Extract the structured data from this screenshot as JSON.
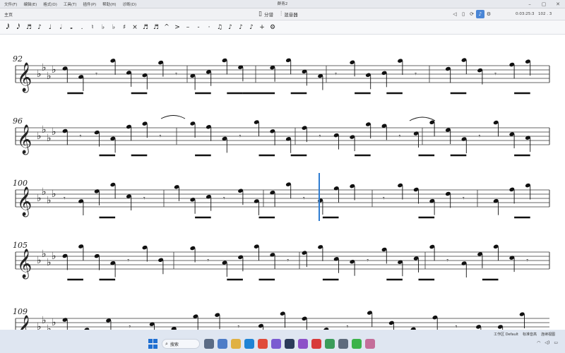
{
  "window": {
    "title": "群青2"
  },
  "menu": {
    "items": [
      "文件(F)",
      "编辑(E)",
      "格式(O)",
      "工具(T)",
      "插件(P)",
      "帮助(H)",
      "诊断(D)"
    ]
  },
  "toolbar1": {
    "home_tab": "主页",
    "mode_split": "分谱",
    "mode_mixer": "混音器",
    "playback_time": "0:03:25:3",
    "measure_beat": "102 . 3"
  },
  "note_toolbar": {
    "items": [
      {
        "name": "sixty-fourth-note",
        "glyph": "𝅘𝅥𝅱"
      },
      {
        "name": "thirty-second-note",
        "glyph": "𝅘𝅥𝅰"
      },
      {
        "name": "sixteenth-note",
        "glyph": "♬"
      },
      {
        "name": "eighth-note",
        "glyph": "♪"
      },
      {
        "name": "quarter-note",
        "glyph": "♩"
      },
      {
        "name": "half-note",
        "glyph": "𝅗𝅥"
      },
      {
        "name": "whole-note",
        "glyph": "𝅝"
      },
      {
        "name": "dot",
        "glyph": "."
      },
      {
        "name": "natural",
        "glyph": "♮"
      },
      {
        "name": "flat",
        "glyph": "♭"
      },
      {
        "name": "double-flat",
        "glyph": "♭"
      },
      {
        "name": "sharp",
        "glyph": "♯"
      },
      {
        "name": "double-sharp",
        "glyph": "×"
      },
      {
        "name": "tie",
        "glyph": "♬"
      },
      {
        "name": "slur",
        "glyph": "♬"
      },
      {
        "name": "accent",
        "glyph": "^"
      },
      {
        "name": "marcato",
        "glyph": ">"
      },
      {
        "name": "tenuto",
        "glyph": "–"
      },
      {
        "name": "staccato",
        "glyph": "-"
      },
      {
        "name": "staccatissimo",
        "glyph": "·"
      },
      {
        "name": "tuplet",
        "glyph": "♫"
      },
      {
        "name": "grace-note",
        "glyph": "♪"
      },
      {
        "name": "flip",
        "glyph": "♪"
      },
      {
        "name": "voice",
        "glyph": "♪"
      },
      {
        "name": "add",
        "glyph": "+"
      },
      {
        "name": "settings",
        "glyph": "⚙"
      }
    ]
  },
  "score": {
    "systems": [
      {
        "measure_number": "92"
      },
      {
        "measure_number": "96"
      },
      {
        "measure_number": "100"
      },
      {
        "measure_number": "105"
      },
      {
        "measure_number": "109"
      }
    ],
    "accent_color": "#2f7dd1"
  },
  "status": {
    "workspace": "工作区 Default",
    "concert_pitch": "标准音高",
    "page_view": "连续视图"
  },
  "taskbar": {
    "search_placeholder": "搜索",
    "icons": [
      "task-view-icon",
      "notepad-icon",
      "folder-icon",
      "edge-icon",
      "chrome-icon",
      "app-icon",
      "musescore-icon",
      "visual-studio-icon",
      "netease-music-icon",
      "vpn-icon",
      "app2-icon",
      "wechat-icon",
      "app3-icon"
    ]
  }
}
